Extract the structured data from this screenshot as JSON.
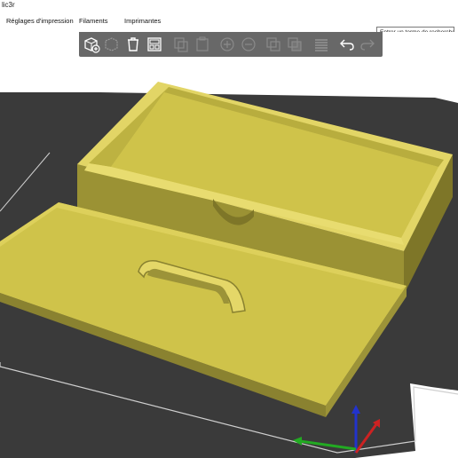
{
  "window": {
    "title": "lic3r"
  },
  "tabs": [
    {
      "label": "Réglages d'impression"
    },
    {
      "label": "Filaments"
    },
    {
      "label": "Imprimantes"
    }
  ],
  "search": {
    "placeholder": "Entrer un terme de recherche"
  },
  "toolbar": {
    "buttons": [
      {
        "name": "add-icon",
        "enabled": true
      },
      {
        "name": "delete-icon",
        "enabled": false
      },
      {
        "name": "delete-all-icon",
        "enabled": true
      },
      {
        "name": "arrange-icon",
        "enabled": true
      },
      {
        "name": "copy-icon",
        "enabled": false
      },
      {
        "name": "paste-icon",
        "enabled": false
      },
      {
        "name": "add-instance-icon",
        "enabled": false
      },
      {
        "name": "remove-instance-icon",
        "enabled": false
      },
      {
        "name": "split-objects-icon",
        "enabled": false
      },
      {
        "name": "split-parts-icon",
        "enabled": false
      },
      {
        "name": "layers-editing-icon",
        "enabled": false
      },
      {
        "name": "undo-icon",
        "enabled": true
      },
      {
        "name": "redo-icon",
        "enabled": false
      }
    ]
  },
  "colors": {
    "model_yellow": "#cfc34a",
    "bed_dark": "#3a3a3a",
    "toolbar_bg": "#686868",
    "axis_x": "#cc2222",
    "axis_y": "#22aa22",
    "axis_z": "#2233cc"
  }
}
